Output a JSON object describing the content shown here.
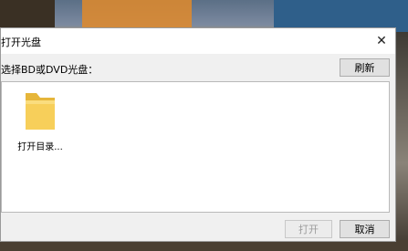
{
  "dialog": {
    "title": "打开光盘",
    "label": "选择BD或DVD光盘：",
    "refresh_label": "刷新",
    "open_label": "打开",
    "cancel_label": "取消",
    "close_glyph": "✕"
  },
  "items": [
    {
      "label": "打开目录...",
      "icon": "folder-icon"
    }
  ],
  "colors": {
    "folder": "#f5c94a",
    "dialog_bg": "#f0f0f0"
  }
}
